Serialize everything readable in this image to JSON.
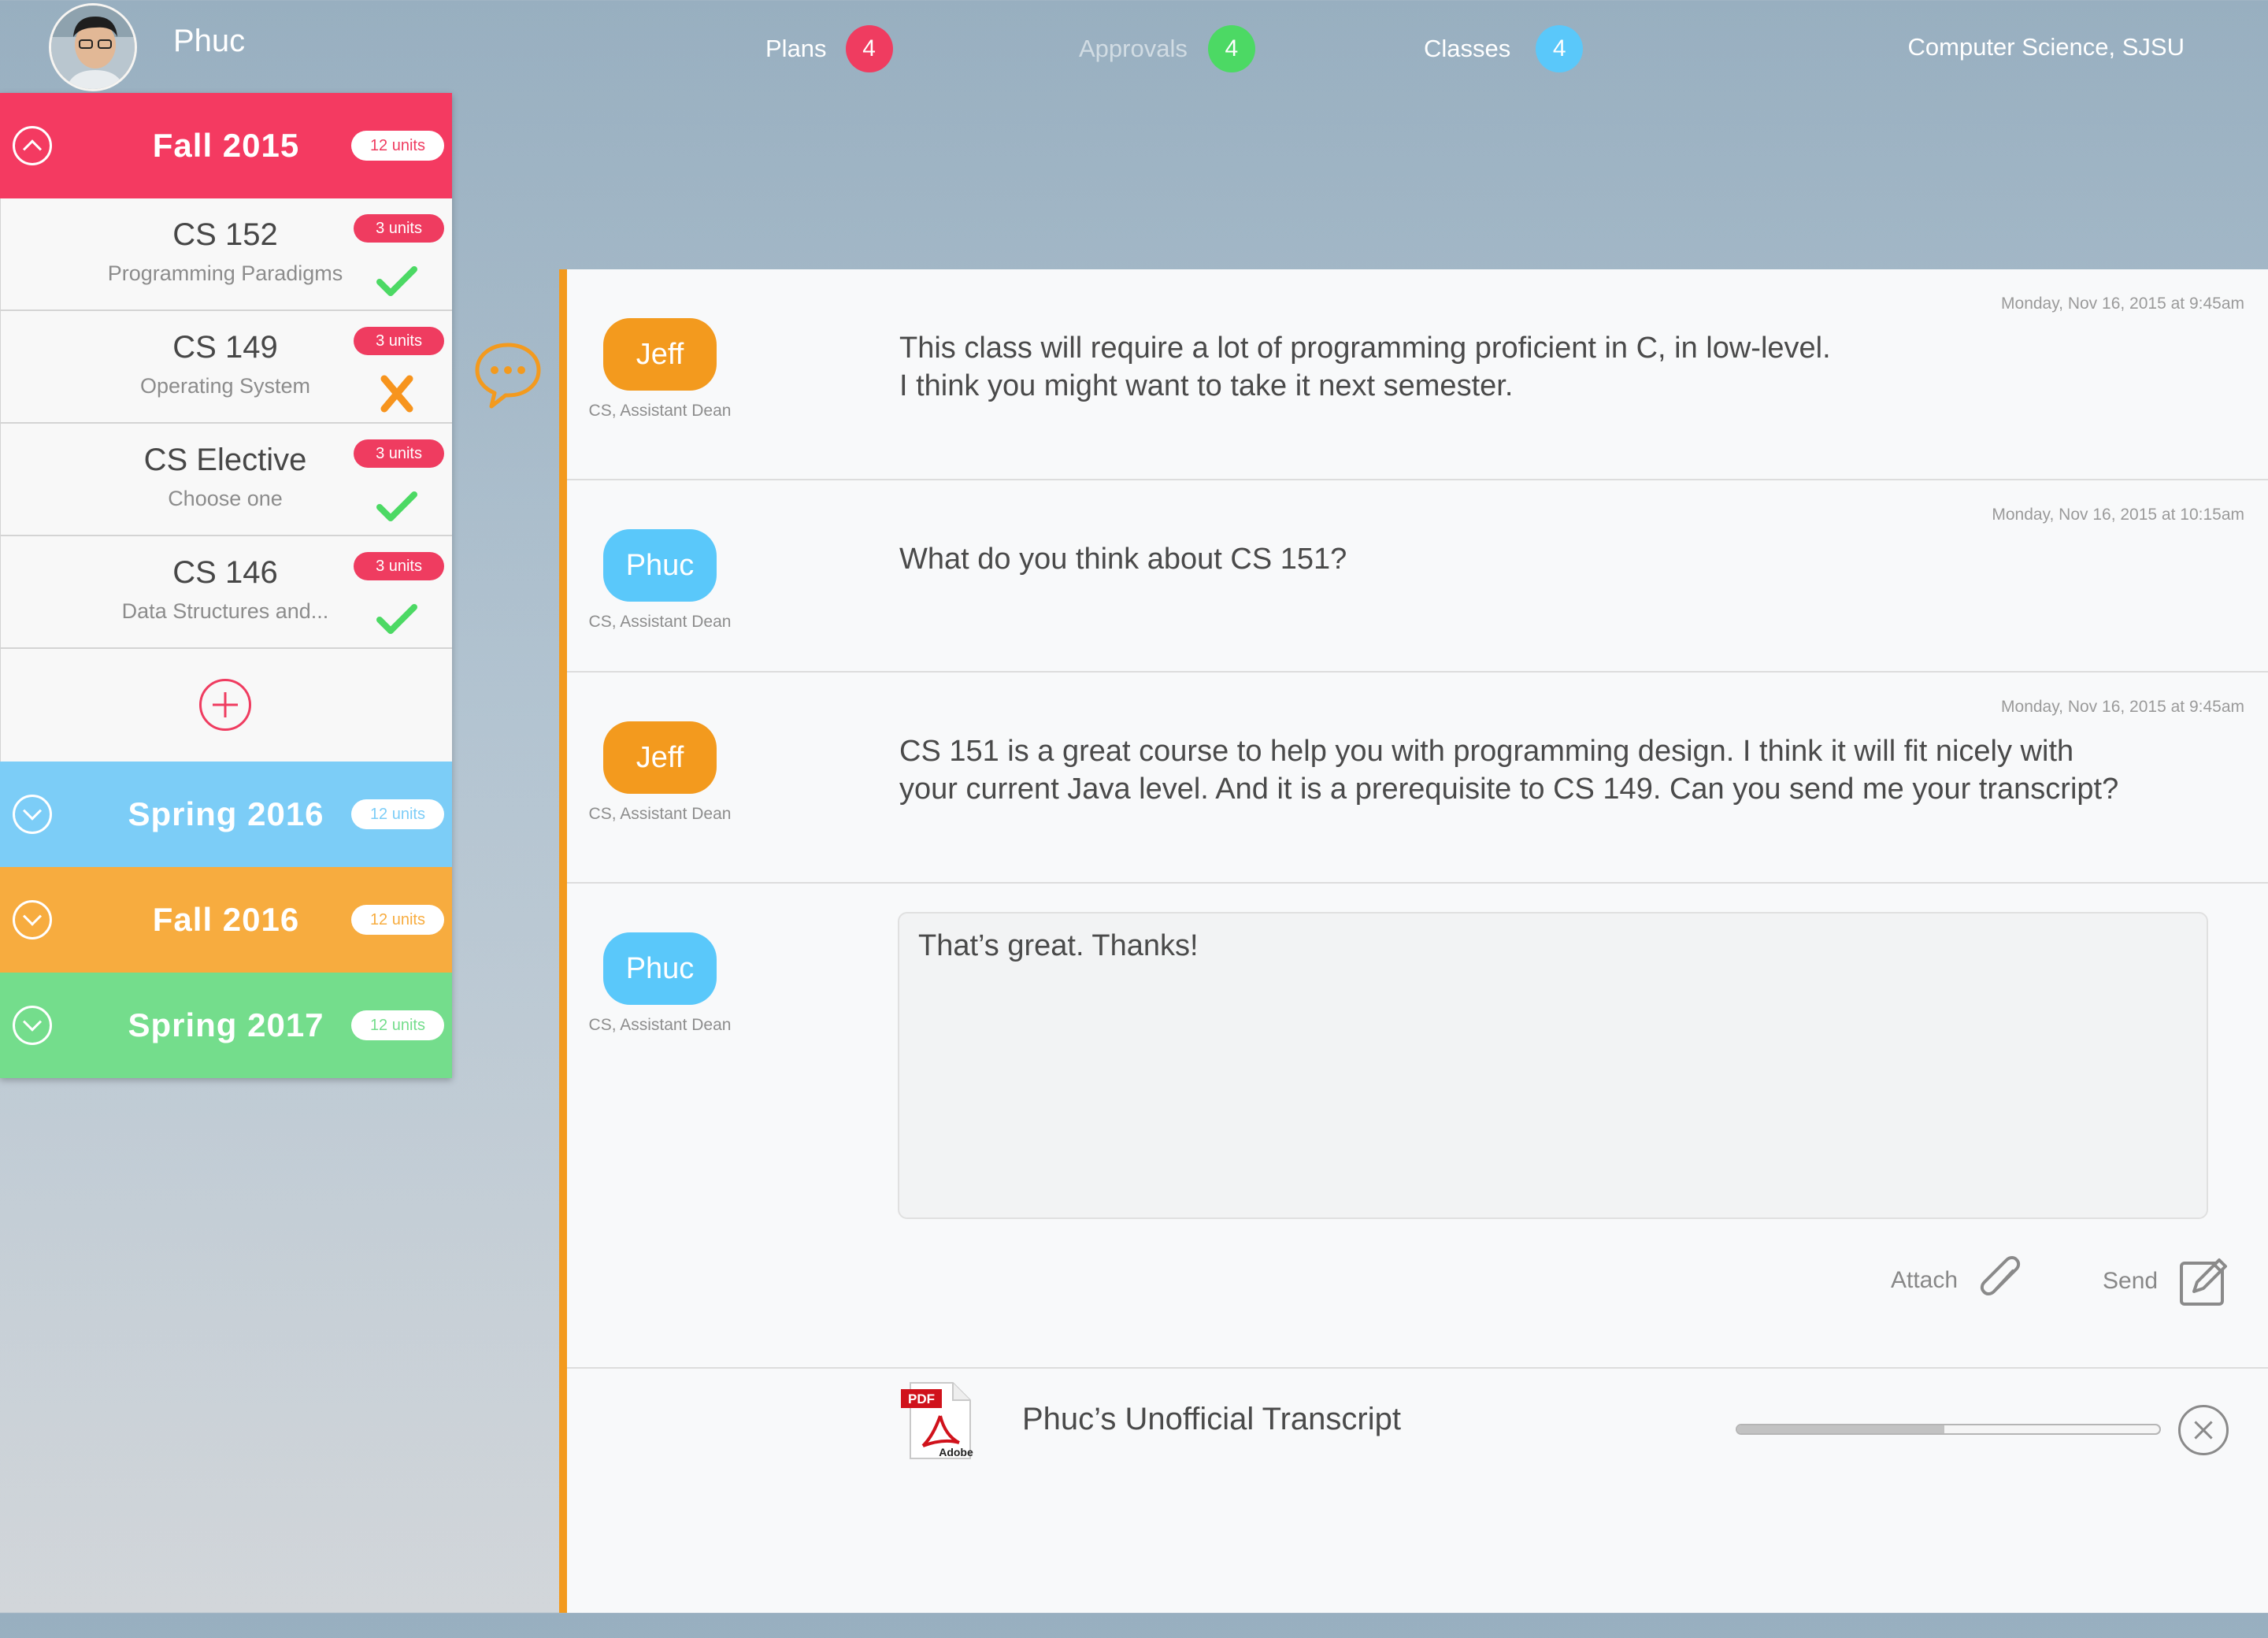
{
  "user": {
    "name": "Phuc"
  },
  "nav": {
    "plans": {
      "label": "Plans",
      "count": "4",
      "color": "#ef3c60"
    },
    "approvals": {
      "label": "Approvals",
      "count": "4",
      "color": "#4cd964"
    },
    "classes": {
      "label": "Classes",
      "count": "4",
      "color": "#5ac8fa"
    },
    "department": "Computer Science, SJSU"
  },
  "semesters": [
    {
      "title": "Fall 2015",
      "units": "12 units",
      "color": "#ef3c60",
      "expanded": true,
      "courses": [
        {
          "code": "CS 152",
          "name": "Programming Paradigms",
          "units": "3 units",
          "status": "approved"
        },
        {
          "code": "CS 149",
          "name": "Operating System",
          "units": "3 units",
          "status": "rejected"
        },
        {
          "code": "CS Elective",
          "name": "Choose one",
          "units": "3 units",
          "status": "approved"
        },
        {
          "code": "CS 146",
          "name": "Data Structures and...",
          "units": "3 units",
          "status": "approved"
        }
      ]
    },
    {
      "title": "Spring 2016",
      "units": "12 units",
      "color": "#7ccdf7",
      "expanded": false
    },
    {
      "title": "Fall 2016",
      "units": "12 units",
      "color": "#f7ac3f",
      "expanded": false
    },
    {
      "title": "Spring 2017",
      "units": "12 units",
      "color": "#74dd8c",
      "expanded": false
    }
  ],
  "messages": [
    {
      "sender": "Jeff",
      "role": "CS, Assistant Dean",
      "time": "Monday, Nov 16, 2015 at 9:45am",
      "text": "This class will require a lot of programming proficient in C, in low-level.\nI think you might want to take it next semester.",
      "color": "#f39a1e"
    },
    {
      "sender": "Phuc",
      "role": "CS, Assistant Dean",
      "time": "Monday, Nov 16, 2015 at 10:15am",
      "text": "What do you think about CS 151?",
      "color": "#5ac8fa"
    },
    {
      "sender": "Jeff",
      "role": "CS, Assistant Dean",
      "time": "Monday, Nov 16, 2015 at 9:45am",
      "text": "CS 151 is a great course to help you with programming design. I think it will fit nicely with\nyour current Java level. And it is a prerequisite to CS 149. Can you send me your transcript?",
      "color": "#f39a1e"
    }
  ],
  "composer": {
    "sender": "Phuc",
    "role": "CS, Assistant Dean",
    "color": "#5ac8fa",
    "value": "That’s great. Thanks!",
    "attach_label": "Attach",
    "send_label": "Send"
  },
  "attachment": {
    "pdf_tag": "PDF",
    "pdf_brand": "Adobe",
    "filename": "Phuc’s Unofficial Transcript",
    "progress": 0.49
  },
  "icons": {
    "status_approved": "check-icon",
    "status_rejected": "x-icon",
    "chat": "chat-bubble-icon",
    "attach": "paperclip-icon",
    "send": "compose-icon",
    "add": "plus-circle-icon",
    "cancel": "close-circle-icon"
  }
}
